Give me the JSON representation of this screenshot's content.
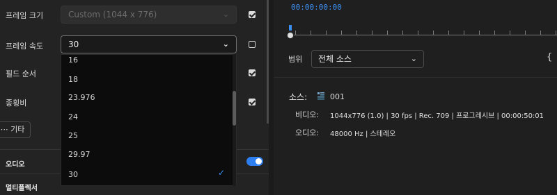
{
  "settings": {
    "frame_size": {
      "label": "프레임 크기",
      "value": "Custom (1044 x 776)",
      "checked": true
    },
    "frame_rate": {
      "label": "프레임 속도",
      "value": "30",
      "checked": false
    },
    "field_order": {
      "label": "필드 순서",
      "checked": true
    },
    "aspect_ratio": {
      "label": "종횡비",
      "checked": true
    },
    "more_button": "⋯ 기타"
  },
  "frame_rate_options": [
    "16",
    "18",
    "23.976",
    "24",
    "25",
    "29.97",
    "30"
  ],
  "frame_rate_selected": "30",
  "sections": {
    "audio": {
      "label": "오디오",
      "enabled": true
    },
    "multiplexer": {
      "label": "멀티플렉서"
    }
  },
  "timeline": {
    "timecode": "00:00:00:00"
  },
  "range": {
    "label": "범위",
    "value": "전체 소스"
  },
  "source": {
    "label": "소스:",
    "name": "001",
    "video_label": "비디오:",
    "video_value": "1044x776 (1.0) | 30 fps | Rec. 709 | 프로그레시브 | 00:00:50:01",
    "audio_label": "오디오:",
    "audio_value": "48000 Hz | 스테레오"
  },
  "colors": {
    "accent": "#3d8ef3",
    "toggle_on": "#2d7ff0",
    "panel_bg": "#232323",
    "dropdown_bg": "#0c0c0c"
  },
  "icons": {
    "dropdown": "chevron-down-icon",
    "selected": "checkmark-icon",
    "sequence": "sequence-icon",
    "range_bracket": "bracket-icon"
  }
}
